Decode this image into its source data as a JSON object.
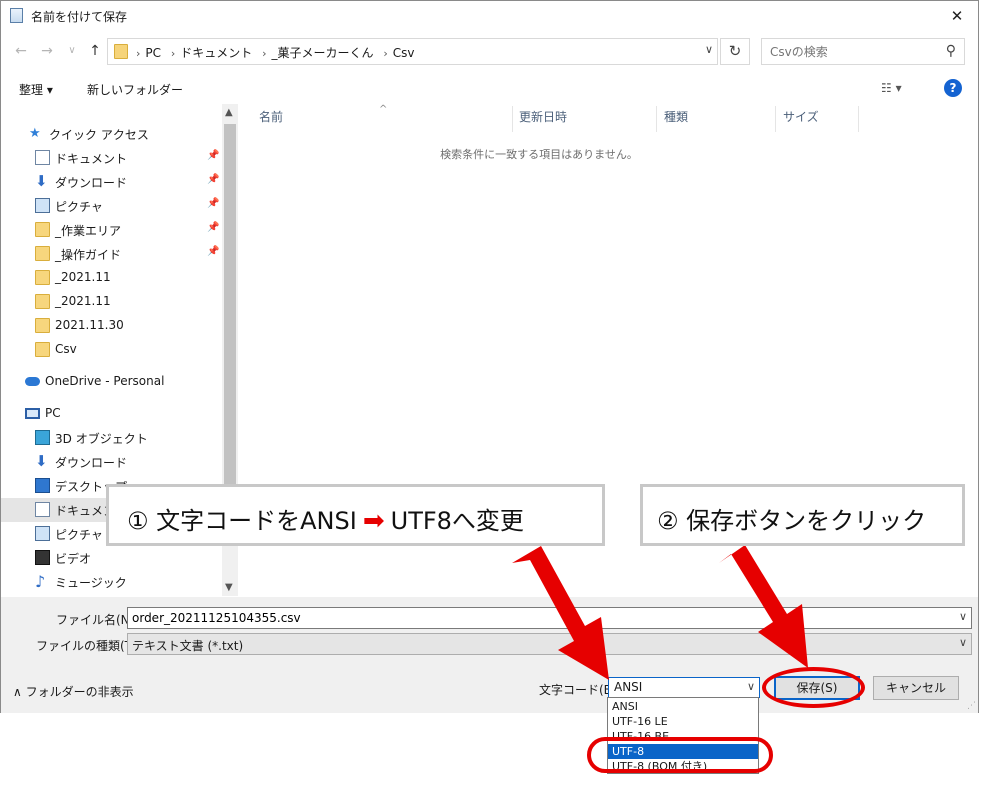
{
  "window": {
    "title": "名前を付けて保存",
    "close_label": "✕"
  },
  "address": {
    "crumbs": [
      "PC",
      "ドキュメント",
      "_菓子メーカーくん",
      "Csv"
    ],
    "search_placeholder": "Csvの検索"
  },
  "commands": {
    "organize": "整理 ▾",
    "new_folder": "新しいフォルダー"
  },
  "nav": {
    "items": [
      {
        "label": "クイック アクセス",
        "icon": "star-icon",
        "pinned": false
      },
      {
        "label": "ドキュメント",
        "icon": "document-icon",
        "pinned": true
      },
      {
        "label": "ダウンロード",
        "icon": "download-icon",
        "pinned": true
      },
      {
        "label": "ピクチャ",
        "icon": "picture-icon",
        "pinned": true
      },
      {
        "label": "_作業エリア",
        "icon": "folder-icon",
        "pinned": true
      },
      {
        "label": "_操作ガイド",
        "icon": "folder-icon",
        "pinned": true
      },
      {
        "label": "_2021.11",
        "icon": "folder-icon",
        "pinned": false
      },
      {
        "label": "_2021.11",
        "icon": "folder-icon",
        "pinned": false
      },
      {
        "label": "2021.11.30",
        "icon": "folder-icon",
        "pinned": false
      },
      {
        "label": "Csv",
        "icon": "folder-icon",
        "pinned": false
      },
      {
        "label": "OneDrive - Personal",
        "icon": "cloud-icon",
        "pinned": false
      },
      {
        "label": "PC",
        "icon": "pc-icon",
        "pinned": false
      },
      {
        "label": "3D オブジェクト",
        "icon": "3d-objects-icon",
        "pinned": false
      },
      {
        "label": "ダウンロード",
        "icon": "download-icon",
        "pinned": false
      },
      {
        "label": "デスクトップ",
        "icon": "desktop-icon",
        "pinned": false
      },
      {
        "label": "ドキュメント",
        "icon": "document-icon",
        "pinned": false
      },
      {
        "label": "ピクチャ",
        "icon": "picture-icon",
        "pinned": false
      },
      {
        "label": "ビデオ",
        "icon": "video-icon",
        "pinned": false
      },
      {
        "label": "ミュージック",
        "icon": "music-icon",
        "pinned": false
      }
    ]
  },
  "filelist": {
    "columns": [
      "名前",
      "更新日時",
      "種類",
      "サイズ"
    ],
    "empty_message": "検索条件に一致する項目はありません。"
  },
  "form": {
    "filename_label": "ファイル名(N):",
    "filename_value": "order_20211125104355.csv",
    "filetype_label": "ファイルの種類(T):",
    "filetype_value": "テキスト文書 (*.txt)",
    "hide_folders": "フォルダーの非表示",
    "encoding_label": "文字コード(E):",
    "encoding_value": "ANSI",
    "encoding_options": [
      "ANSI",
      "UTF-16 LE",
      "UTF-16 BE",
      "UTF-8",
      "UTF-8 (BOM 付き)"
    ],
    "encoding_selected": "UTF-8",
    "save_label": "保存(S)",
    "cancel_label": "キャンセル"
  },
  "annotations": {
    "step1": "① 文字コードをANSI",
    "step1_arrow": "➡",
    "step1_tail": "UTF8へ変更",
    "step2": "② 保存ボタンをクリック",
    "highlight_color": "#e60000"
  }
}
